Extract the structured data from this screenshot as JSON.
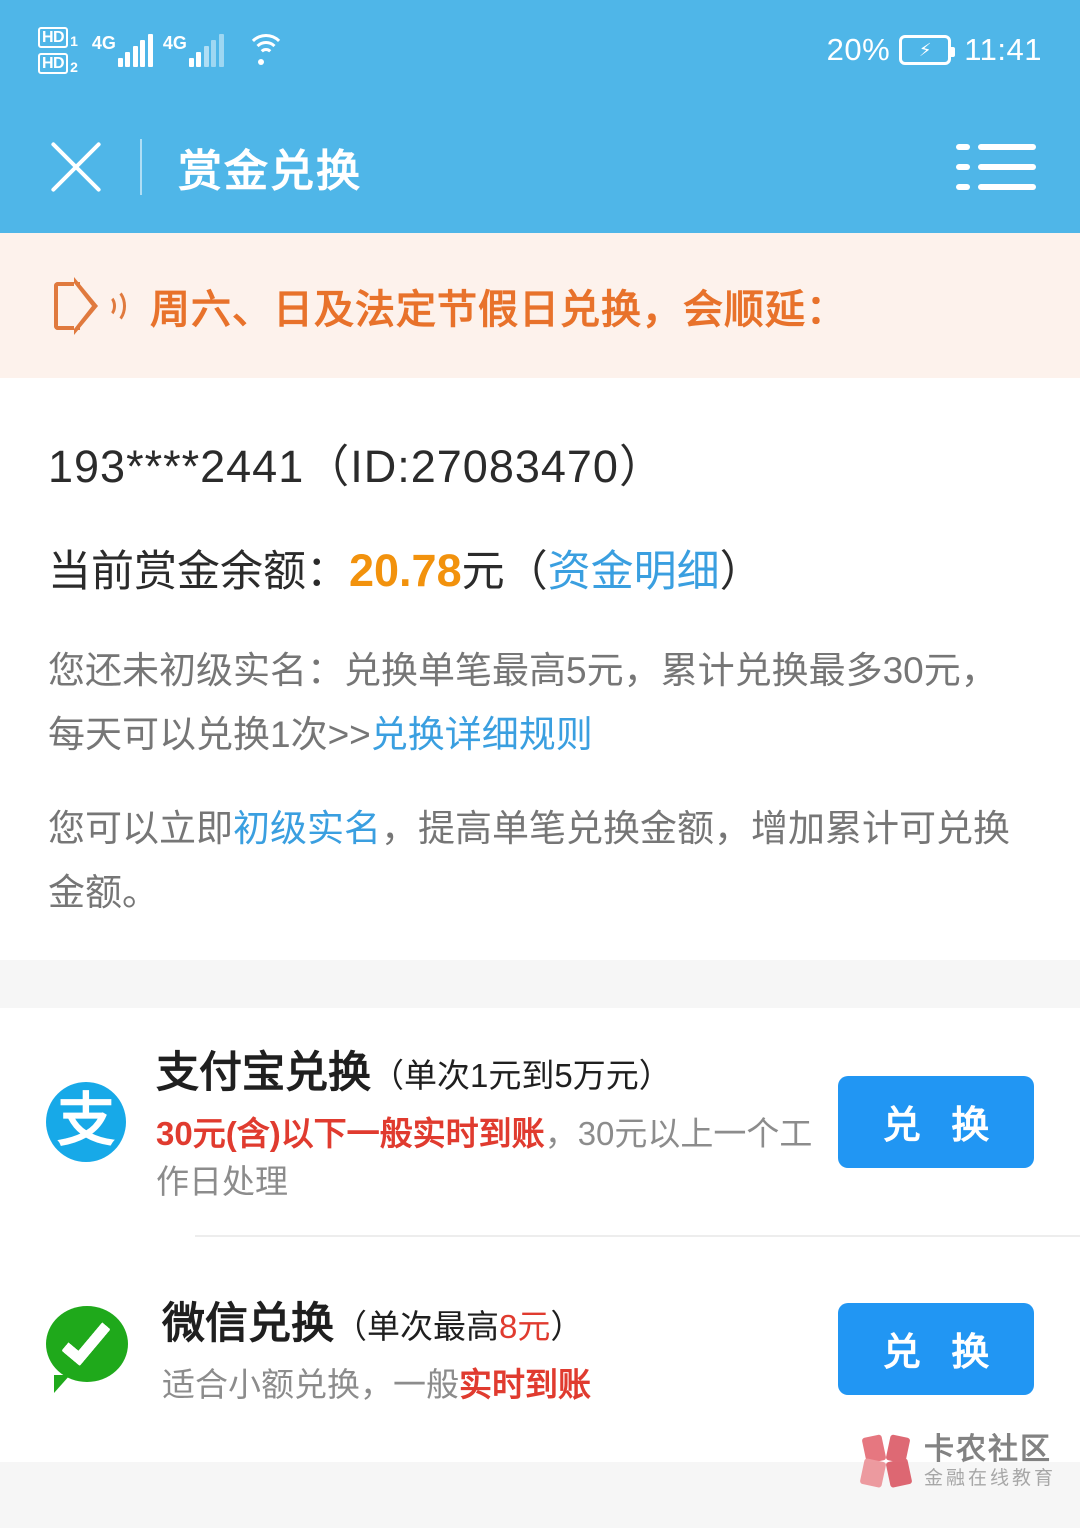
{
  "status_bar": {
    "hd1_label": "HD",
    "hd1_num": "1",
    "hd2_label": "HD",
    "hd2_num": "2",
    "network_1": "4G",
    "network_2": "4G",
    "wifi_icon": "wifi-icon",
    "battery_percent": "20%",
    "battery_icon": "battery-charging-icon",
    "time": "11:41"
  },
  "header": {
    "close_icon": "close-icon",
    "title": "赏金兑换",
    "menu_icon": "list-menu-icon"
  },
  "notice": {
    "icon": "speaker-horn-icon",
    "text": "周六、日及法定节假日兑换，会顺延："
  },
  "account": {
    "phone_and_id": "193****2441（ID:27083470）",
    "balance_label": "当前赏金余额：",
    "balance_amount": "20.78",
    "balance_unit": "元",
    "paren_open": "（",
    "detail_link": "资金明细",
    "paren_close": "）",
    "note1_part1": "您还未初级实名：兑换单笔最高5元，累计兑换最多30元，每天可以兑换1次>>",
    "note1_link": "兑换详细规则",
    "note2_part1": "您可以立即",
    "note2_link": "初级实名",
    "note2_part2": "，提高单笔兑换金额，增加累计可兑换金额。"
  },
  "methods": [
    {
      "icon": "alipay-icon",
      "icon_glyph": "支",
      "title": "支付宝兑换",
      "title_sub": "（单次1元到5万元）",
      "desc_red": "30元(含)以下一般实时到账",
      "desc_gray": "，30元以上一个工作日处理",
      "button_label": "兑 换"
    },
    {
      "icon": "wechat-icon",
      "title": "微信兑换",
      "title_sub_pre": "（单次最高",
      "title_sub_red": "8元",
      "title_sub_post": "）",
      "desc_gray_pre": "适合小额兑换，一般",
      "desc_red": "实时到账",
      "button_label": "兑 换"
    }
  ],
  "watermark": {
    "name": "卡农社区",
    "slogan": "金融在线教育"
  },
  "colors": {
    "header_blue": "#4fb6e8",
    "notice_bg": "#fdf2ec",
    "notice_orange": "#e8722b",
    "amount_orange": "#f2920d",
    "link_blue": "#3a9fe0",
    "button_blue": "#2196f3",
    "alipay_blue": "#17a9e8",
    "wechat_green": "#1fa91b",
    "warn_red": "#e03b2f"
  }
}
